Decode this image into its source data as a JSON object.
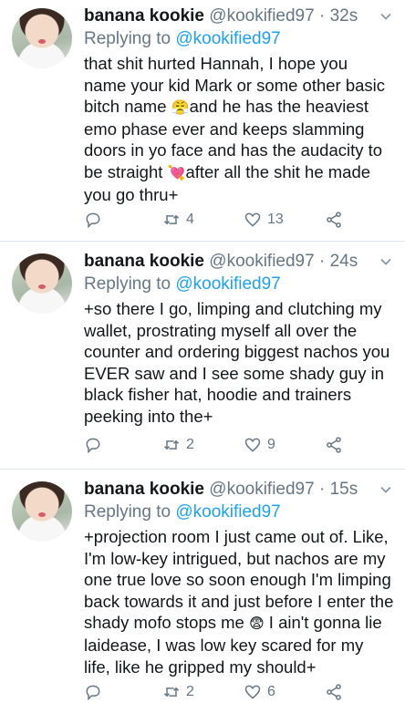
{
  "tweets": [
    {
      "name": "banana kookie",
      "handle": "@kookified97",
      "sep": "·",
      "time": "32s",
      "replying_prefix": "Replying to",
      "replying_to": "@kookified97",
      "text_parts": [
        "that shit hurted Hannah, I hope you name your kid Mark or some other basic bitch name ",
        "and he has the heaviest emo phase ever and keeps slamming doors in yo face and has the audacity to be straight ",
        "after all the shit he made you go thru+"
      ],
      "emojis": [
        "😤",
        "💘"
      ],
      "retweets": "4",
      "likes": "13"
    },
    {
      "name": "banana kookie",
      "handle": "@kookified97",
      "sep": "·",
      "time": "24s",
      "replying_prefix": "Replying to",
      "replying_to": "@kookified97",
      "text": "+so there I go, limping and clutching my wallet, prostrating myself all over the counter and ordering biggest nachos you EVER saw and I see some shady guy in black fisher hat, hoodie and trainers peeking into the+",
      "retweets": "2",
      "likes": "9"
    },
    {
      "name": "banana kookie",
      "handle": "@kookified97",
      "sep": "·",
      "time": "15s",
      "replying_prefix": "Replying to",
      "replying_to": "@kookified97",
      "text_parts": [
        "+projection room I just came out of. Like, I'm low-key intrigued, but nachos are my one true love so soon enough I'm limping back towards it and just before I enter the shady mofo stops me ",
        " I ain't gonna lie laidease, I was low key scared for my life, like he gripped my should+"
      ],
      "emojis": [
        "😨"
      ],
      "retweets": "2",
      "likes": "6"
    }
  ],
  "icons": {
    "reply": "reply-icon",
    "retweet": "retweet-icon",
    "like": "heart-icon",
    "share": "share-icon",
    "caret": "chevron-down-icon"
  },
  "colors": {
    "text": "#14171a",
    "muted": "#657786",
    "link": "#1da1f2",
    "divider": "#e1e8ed"
  }
}
